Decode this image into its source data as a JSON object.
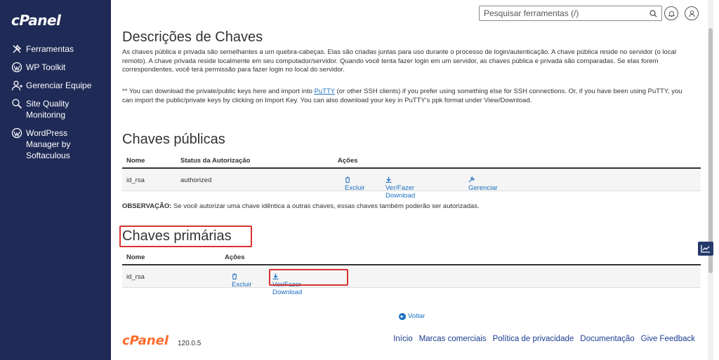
{
  "brand": {
    "logo_text": "cPanel",
    "version": "120.0.5"
  },
  "sidebar": {
    "items": [
      {
        "label": "Ferramentas",
        "icon": "tools-icon"
      },
      {
        "label": "WP Toolkit",
        "icon": "wordpress-icon"
      },
      {
        "label": "Gerenciar Equipe",
        "icon": "team-icon"
      },
      {
        "label": "Site Quality\nMonitoring",
        "icon": "search-gear-icon"
      },
      {
        "label": "WordPress\nManager by\nSoftaculous",
        "icon": "wordpress-icon"
      }
    ]
  },
  "search": {
    "placeholder": "Pesquisar ferramentas (/)"
  },
  "page": {
    "title": "Descrições de Chaves",
    "description": "As chaves pública e privada são semelhantes a um quebra-cabeças. Elas são criadas juntas para uso durante o processo de login/autenticação. A chave pública reside no servidor (o local remoto). A chave privada reside localmente em seu computador/servidor. Quando você tenta fazer login em um servidor, as chaves pública e privada são comparadas. Se elas forem correspondentes, você terá permissão para fazer login no local do servidor.",
    "note_prefix": "** You can download the private/public keys here and import into ",
    "note_link": "PuTTY",
    "note_suffix": " (or other SSH clients) if you prefer using something else for SSH connections. Or, if you have been using PuTTY, you can import the public/private keys by clicking on Import Key. You can also download your key in PuTTY's ppk format under View/Download."
  },
  "public_keys": {
    "title": "Chaves públicas",
    "headers": {
      "name": "Nome",
      "status": "Status da Autorização",
      "actions": "Ações"
    },
    "rows": [
      {
        "name": "id_rsa",
        "status": "authorized",
        "delete": "Excluir",
        "download": "Ver/Fazer Download",
        "manage": "Gerenciar"
      }
    ],
    "note_label": "OBSERVAÇÃO:",
    "note_text": " Se você autorizar uma chave idêntica a outras chaves, essas chaves também poderão ser autorizadas."
  },
  "private_keys": {
    "title": "Chaves primárias",
    "headers": {
      "name": "Nome",
      "actions": "Ações"
    },
    "rows": [
      {
        "name": "id_rsa",
        "delete": "Excluir",
        "download": "Ver/Fazer Download"
      }
    ]
  },
  "back_link": "Voltar",
  "footer": {
    "links": [
      "Início",
      "Marcas comerciais",
      "Política de privacidade",
      "Documentação",
      "Give Feedback"
    ]
  },
  "colors": {
    "sidebar_bg": "#202a56",
    "link": "#1a6fc0",
    "highlight": "#d9322e",
    "brand_orange": "#ff6c2c"
  }
}
